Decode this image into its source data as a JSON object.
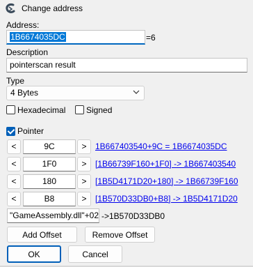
{
  "window": {
    "title": "Change address",
    "icon": "cheat-engine-icon"
  },
  "address": {
    "label": "Address:",
    "value": "1B6674035DC",
    "suffix": "=6"
  },
  "description": {
    "label": "Description",
    "value": "pointerscan result"
  },
  "type": {
    "label": "Type",
    "selected": "4 Bytes"
  },
  "options": {
    "hexadecimal": "Hexadecimal",
    "signed": "Signed"
  },
  "pointer": {
    "label": "Pointer",
    "checked": true,
    "offsets": [
      {
        "dec": "<",
        "value": "9C",
        "inc": ">",
        "result": "1B667403540+9C = 1B6674035DC"
      },
      {
        "dec": "<",
        "value": "1F0",
        "inc": ">",
        "result": "[1B66739F160+1F0] -> 1B667403540"
      },
      {
        "dec": "<",
        "value": "180",
        "inc": ">",
        "result": "[1B5D4171D20+180] -> 1B66739F160"
      },
      {
        "dec": "<",
        "value": "B8",
        "inc": ">",
        "result": "[1B570D33DB0+B8] -> 1B5D4171D20"
      }
    ],
    "base": {
      "value": "\"GameAssembly.dll\"+02",
      "result": "->1B570D33DB0"
    }
  },
  "buttons": {
    "add_offset": "Add Offset",
    "remove_offset": "Remove Offset",
    "ok": "OK",
    "cancel": "Cancel"
  },
  "colors": {
    "accent": "#005fb8",
    "link": "#0000ee",
    "selection": "#0078d7"
  }
}
